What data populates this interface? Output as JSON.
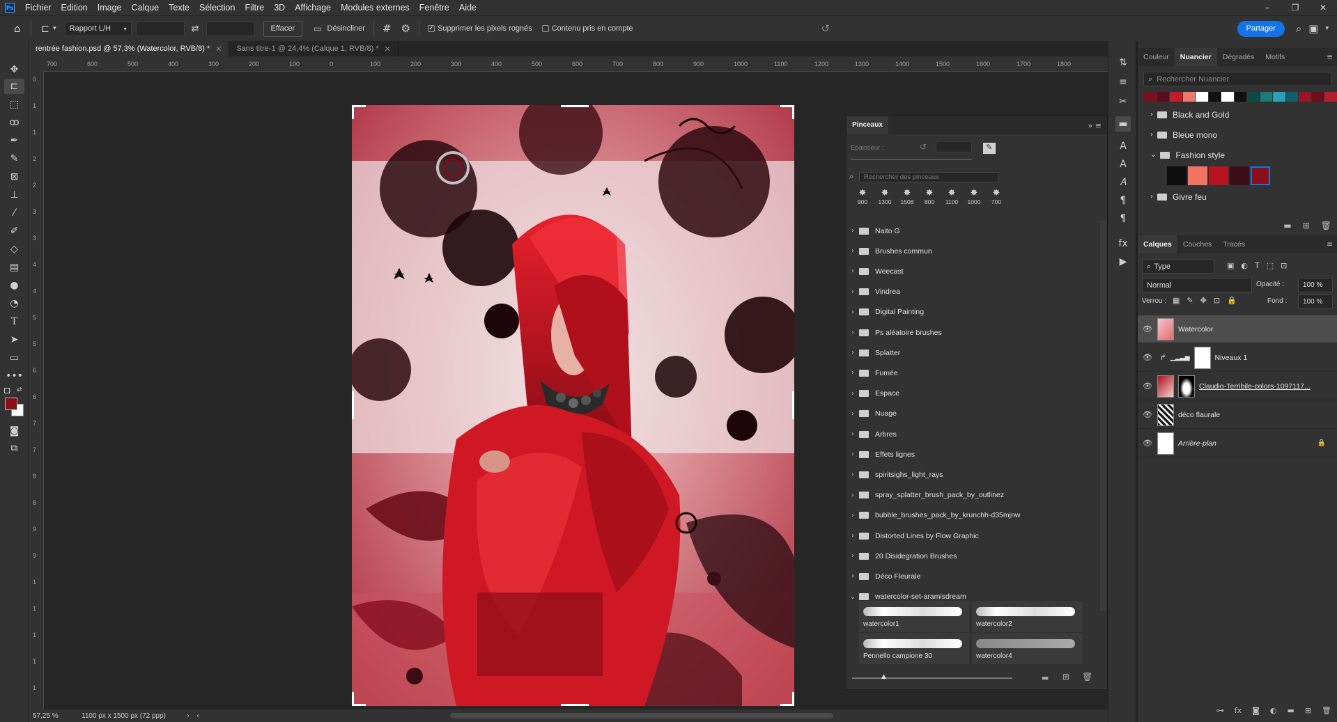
{
  "menu": {
    "app_icon": "Ps",
    "items": [
      "Fichier",
      "Edition",
      "Image",
      "Calque",
      "Texte",
      "Sélection",
      "Filtre",
      "3D",
      "Affichage",
      "Modules externes",
      "Fenêtre",
      "Aide"
    ]
  },
  "options": {
    "ratio_label": "Rapport L/H",
    "clear_label": "Effacer",
    "straighten_label": "Désincliner",
    "delete_cropped_label": "Supprimer les pixels rognés",
    "delete_cropped_checked": true,
    "content_aware_label": "Contenu pris en compte",
    "content_aware_checked": false,
    "share_label": "Partager"
  },
  "doc_tabs": [
    {
      "label": "rentrée fashion.psd @ 57,3% (Watercolor, RVB/8) *",
      "active": true
    },
    {
      "label": "Sans titre-1 @ 24,4% (Calque 1, RVB/8) *",
      "active": false
    }
  ],
  "ruler_h": [
    "700",
    "600",
    "500",
    "400",
    "300",
    "200",
    "100",
    "0",
    "100",
    "200",
    "300",
    "400",
    "500",
    "600",
    "700",
    "800",
    "900",
    "1000",
    "1100",
    "1200",
    "1300",
    "1400",
    "1500",
    "1600",
    "1700",
    "1800"
  ],
  "ruler_v": [
    "0",
    "1",
    "1",
    "2",
    "2",
    "3",
    "3",
    "4",
    "4",
    "5",
    "5",
    "6",
    "6",
    "7",
    "7",
    "8",
    "8",
    "9",
    "9",
    "1",
    "1",
    "1",
    "1",
    "1"
  ],
  "status": {
    "zoom": "57,25 %",
    "doc_info": "1100 px x 1500 px (72 ppp)"
  },
  "brushes": {
    "title": "Pinceaux",
    "size_label": "Epaisseur :",
    "search_placeholder": "Rechercher des pinceaux",
    "presets": [
      "900",
      "1300",
      "1508",
      "800",
      "1100",
      "1000",
      "700"
    ],
    "groups": [
      "Naito G",
      "Brushes commun",
      "Weecast",
      "Vindrea",
      "Digital Painting",
      "Ps aléatoire brushes",
      "Splatter",
      "Fumée",
      "Espace",
      "Nuage",
      "Arbres",
      "Effets lignes",
      "spiritsighs_light_rays",
      "spray_splatter_brush_pack_by_outlinez",
      "bubble_brushes_pack_by_krunchh-d35mjnw",
      "Distorted Lines by Flow Graphic",
      "20 Disidegration Brushes",
      "Déco Fleurale",
      "watercolor-set-aramisdream"
    ],
    "strokes": [
      "watercolor1",
      "watercolor2",
      "Pennello campione 30",
      "watercolor4"
    ]
  },
  "swatches_panel": {
    "tabs": [
      "Couleur",
      "Nuancier",
      "Dégradés",
      "Motifs"
    ],
    "active_tab": "Nuancier",
    "search_placeholder": "Rechercher Nuancier",
    "recent_colors": [
      "#7a1020",
      "#5a0d1a",
      "#c21d2e",
      "#f07a6a",
      "#ffffff",
      "#111111",
      "#ffffff",
      "#101010",
      "#0d4a46",
      "#1b7b77",
      "#2aa0b8",
      "#0f5e6c",
      "#9c1428",
      "#6b0d1c",
      "#b51c2e"
    ],
    "groups": [
      {
        "name": "Black and Gold",
        "open": false
      },
      {
        "name": "Bleue mono",
        "open": false
      },
      {
        "name": "Fashion style",
        "open": true,
        "colors": [
          "#0e0e0f",
          "#f27563",
          "#b8141f",
          "#3c0e16",
          "#8a0d17"
        ]
      },
      {
        "name": "Givre feu",
        "open": false
      }
    ]
  },
  "layers_panel": {
    "tabs": [
      "Calques",
      "Couches",
      "Tracés"
    ],
    "active_tab": "Calques",
    "filter_label": "Type",
    "blend_mode": "Normal",
    "opacity_label": "Opacité :",
    "opacity_value": "100 %",
    "lock_label": "Verrou :",
    "fill_label": "Fond :",
    "fill_value": "100 %",
    "layers": [
      {
        "name": "Watercolor",
        "selected": true
      },
      {
        "name": "Niveaux 1",
        "selected": false
      },
      {
        "name": "Claudio-Terribile-colors-1097117...",
        "selected": false
      },
      {
        "name": "déco flaurale",
        "selected": false
      },
      {
        "name": "Arrière-plan",
        "selected": false
      }
    ]
  }
}
